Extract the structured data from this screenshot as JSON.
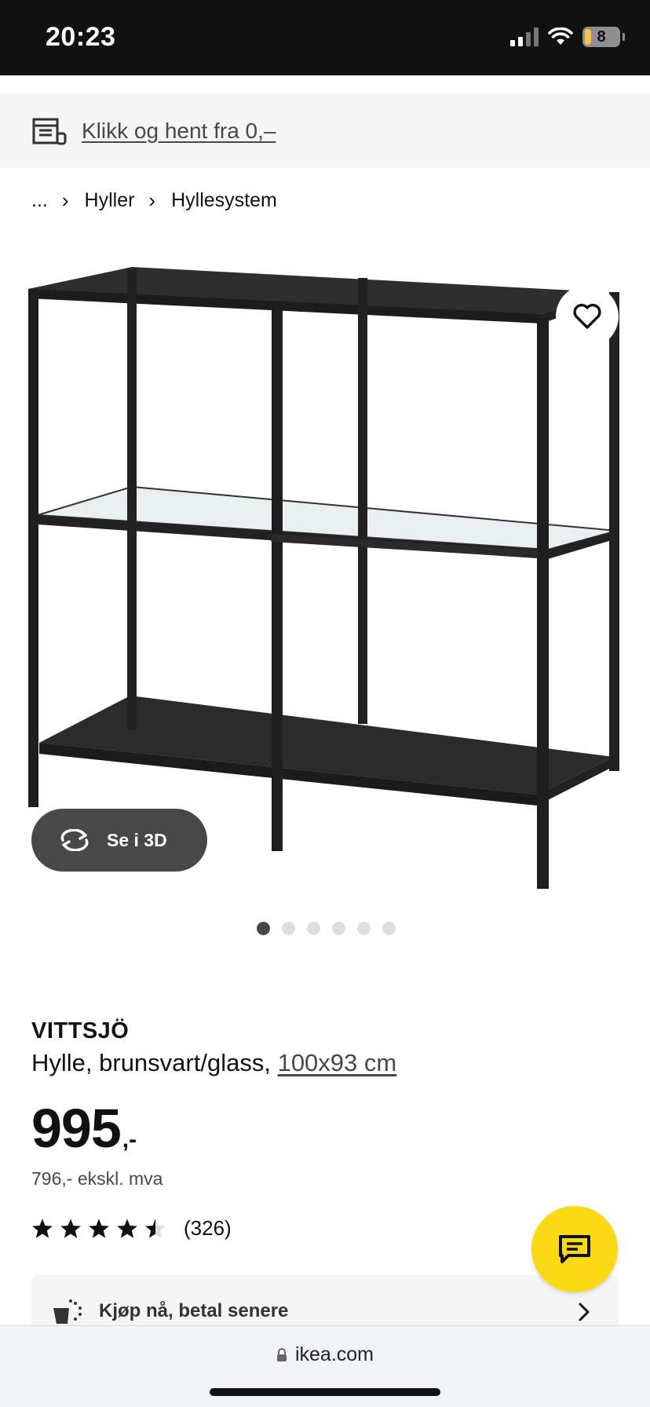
{
  "status_bar": {
    "time": "20:23",
    "battery": "8"
  },
  "click_collect": {
    "label": "Klikk og hent fra 0,–"
  },
  "breadcrumb": {
    "items": [
      "...",
      "Hyller",
      "Hyllesystem"
    ]
  },
  "media": {
    "see_3d_label": "Se i 3D",
    "image_count": 6,
    "active_index": 0
  },
  "product": {
    "name": "VITTSJÖ",
    "description": "Hylle, brunsvart/glass,",
    "size_link": "100x93 cm",
    "price_main": "995",
    "price_suffix": ",-",
    "price_ex_vat": "796,- ekskl. mva",
    "rating_value": 4.6,
    "rating_count": "(326)"
  },
  "payment": {
    "label": "Kjøp nå, betal senere"
  },
  "browser": {
    "url": "ikea.com"
  },
  "colors": {
    "chat_yellow": "#fbd914",
    "dark_button": "#484848",
    "banner_bg": "#f5f5f5"
  },
  "icons": [
    "store-icon",
    "heart-icon",
    "rotate-3d-icon",
    "chat-icon",
    "klarna-icon",
    "chevron-right-icon",
    "lock-icon"
  ]
}
